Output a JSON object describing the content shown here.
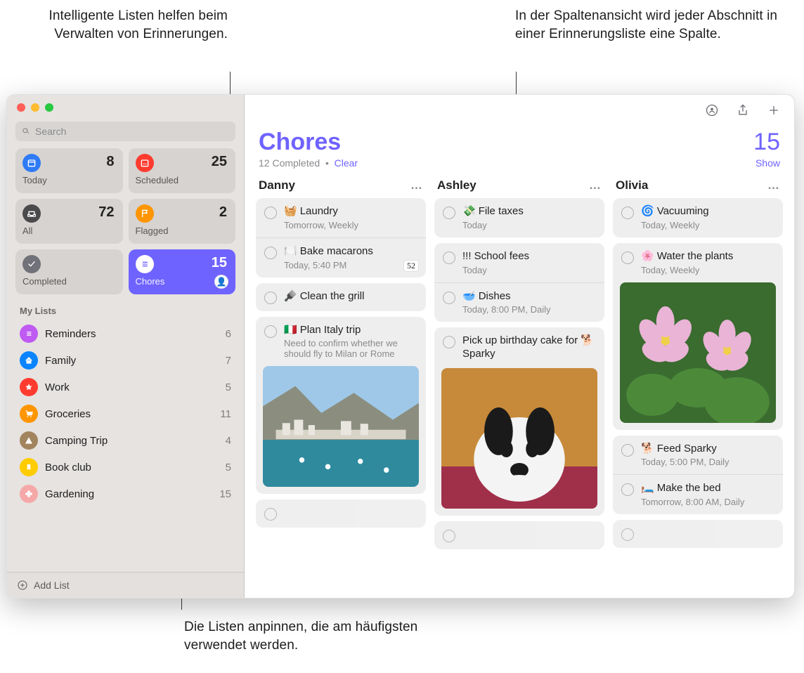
{
  "callouts": {
    "top_left": "Intelligente Listen helfen beim Verwalten von Erinnerungen.",
    "top_right": "In der Spaltenansicht wird jeder Abschnitt in einer Erinnerungsliste eine Spalte.",
    "bottom": "Die Listen anpinnen, die am häufigsten verwendet werden."
  },
  "sidebar": {
    "search_placeholder": "Search",
    "smart": [
      {
        "label": "Today",
        "count": "8",
        "icon": "calendar",
        "bg": "#2f7bf6"
      },
      {
        "label": "Scheduled",
        "count": "25",
        "icon": "calendar-dots",
        "bg": "#ff3b30"
      },
      {
        "label": "All",
        "count": "72",
        "icon": "tray",
        "bg": "#4a4a4d"
      },
      {
        "label": "Flagged",
        "count": "2",
        "icon": "flag",
        "bg": "#ff9500"
      },
      {
        "label": "Completed",
        "count": "",
        "icon": "check",
        "bg": "#71717a"
      },
      {
        "label": "Chores",
        "count": "15",
        "icon": "list",
        "bg": "#6f63ff",
        "active": true,
        "avatar": "👤"
      }
    ],
    "section": "My Lists",
    "lists": [
      {
        "name": "Reminders",
        "count": "6",
        "color": "#bf5af2",
        "icon": "list"
      },
      {
        "name": "Family",
        "count": "7",
        "color": "#0a84ff",
        "icon": "home"
      },
      {
        "name": "Work",
        "count": "5",
        "color": "#ff3b30",
        "icon": "star"
      },
      {
        "name": "Groceries",
        "count": "11",
        "color": "#ff9500",
        "icon": "cart"
      },
      {
        "name": "Camping Trip",
        "count": "4",
        "color": "#a2845e",
        "icon": "tent"
      },
      {
        "name": "Book club",
        "count": "5",
        "color": "#ffcc00",
        "icon": "bookmark"
      },
      {
        "name": "Gardening",
        "count": "15",
        "color": "#f4a9a8",
        "icon": "flower"
      }
    ],
    "add_list": "Add List"
  },
  "header": {
    "title": "Chores",
    "count": "15",
    "completed": "12 Completed",
    "clear": "Clear",
    "show": "Show"
  },
  "columns": [
    {
      "name": "Danny",
      "groups": [
        [
          {
            "emoji": "🧺",
            "title": "Laundry",
            "sub": "Tomorrow, Weekly"
          },
          {
            "emoji": "🍽️",
            "title": "Bake macarons",
            "sub": "Today, 5:40 PM",
            "chip": "52"
          }
        ],
        [
          {
            "emoji": "🪮",
            "title": "Clean the grill"
          }
        ],
        [
          {
            "emoji": "🇮🇹",
            "title": "Plan Italy trip",
            "sub": "Need to confirm whether we should fly to Milan or Rome",
            "image": "coast"
          }
        ],
        [
          {
            "empty": true
          }
        ]
      ]
    },
    {
      "name": "Ashley",
      "groups": [
        [
          {
            "emoji": "💸",
            "title": "File taxes",
            "sub": "Today"
          }
        ],
        [
          {
            "emoji": "",
            "title": "!!! School fees",
            "sub": "Today"
          },
          {
            "emoji": "🥣",
            "title": "Dishes",
            "sub": "Today, 8:00 PM, Daily"
          }
        ],
        [
          {
            "emoji": "",
            "title": "Pick up birthday cake for 🐕 Sparky",
            "image": "dog"
          }
        ],
        [
          {
            "empty": true
          }
        ]
      ]
    },
    {
      "name": "Olivia",
      "groups": [
        [
          {
            "emoji": "🌀",
            "title": "Vacuuming",
            "sub": "Today, Weekly"
          }
        ],
        [
          {
            "emoji": "🌸",
            "title": "Water the plants",
            "sub": "Today, Weekly",
            "image": "flowers"
          }
        ],
        [
          {
            "emoji": "🐕",
            "title": "Feed Sparky",
            "sub": "Today, 5:00 PM, Daily"
          },
          {
            "emoji": "🛏️",
            "title": "Make the bed",
            "sub": "Tomorrow, 8:00 AM, Daily"
          }
        ],
        [
          {
            "empty": true
          }
        ]
      ]
    }
  ]
}
